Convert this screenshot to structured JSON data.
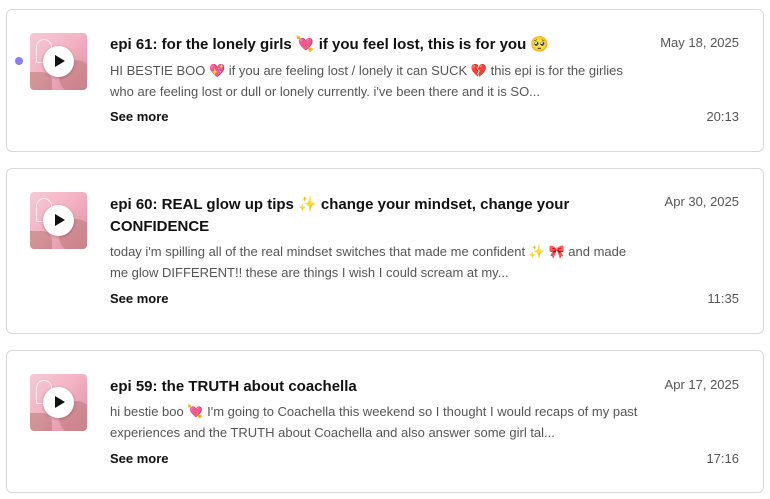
{
  "episodes": [
    {
      "title": "epi 61: for the lonely girls 💘 if you feel lost, this is for you 🥺",
      "description": "HI BESTIE BOO 💖 if you are feeling lost / lonely it can SUCK 💔 this epi is for the girlies who are feeling lost or dull or lonely currently. i've been there and it is SO...",
      "date": "May 18, 2025",
      "duration": "20:13",
      "see_more_label": "See more",
      "unplayed": true
    },
    {
      "title": "epi 60: REAL glow up tips ✨ change your mindset, change your CONFIDENCE",
      "description": "today i'm spilling all of the real mindset switches that made me confident ✨ 🎀 and made me glow DIFFERENT!! these are things I wish I could scream at my...",
      "date": "Apr 30, 2025",
      "duration": "11:35",
      "see_more_label": "See more",
      "unplayed": false
    },
    {
      "title": "epi 59: the TRUTH about coachella",
      "description": "hi bestie boo 💘 I'm going to Coachella this weekend so I thought I would recaps of my past experiences and the TRUTH about Coachella and also answer some girl tal...",
      "date": "Apr 17, 2025",
      "duration": "17:16",
      "see_more_label": "See more",
      "unplayed": false
    }
  ],
  "colors": {
    "unplayed_dot": "#8b7cf6",
    "card_border": "#d9d9d9",
    "text_primary": "#111111",
    "text_secondary": "#555555"
  },
  "icons": {
    "play": "play-icon",
    "thumbnail": "podcast-cover-art"
  }
}
